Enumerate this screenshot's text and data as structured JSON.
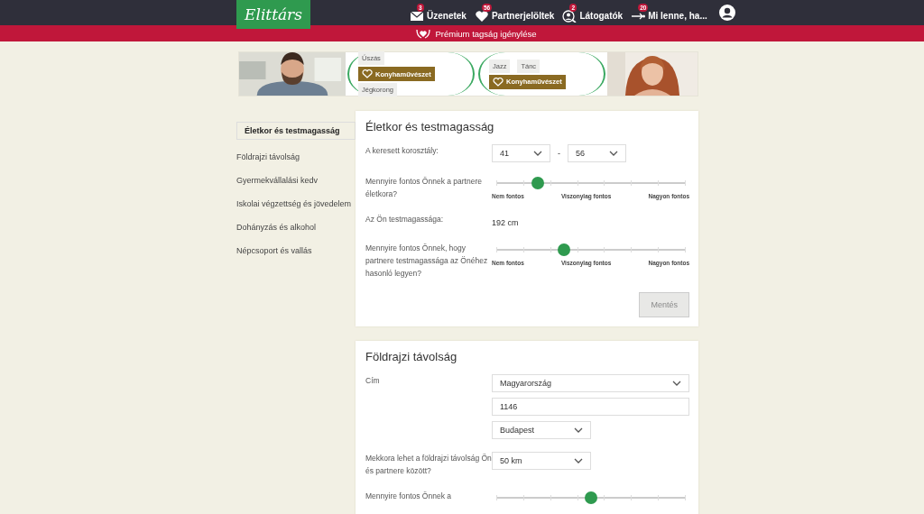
{
  "header": {
    "logo": "Elittárs",
    "nav": [
      {
        "badge": "3",
        "label": "Üzenetek"
      },
      {
        "badge": "56",
        "label": "Partnerjelöltek"
      },
      {
        "badge": "2",
        "label": "Látogatók"
      },
      {
        "badge": "20",
        "label": "Mi lenne, ha..."
      }
    ]
  },
  "premium_bar": {
    "label": "Prémium tagság igénylése"
  },
  "banner": {
    "left_tags": [
      {
        "label": "Úszás",
        "kind": "plain"
      },
      {
        "label": "Konyhaművészet",
        "kind": "featured"
      },
      {
        "label": "Jégkorong",
        "kind": "plain"
      }
    ],
    "right_tags": [
      {
        "label": "Jazz",
        "kind": "plain"
      },
      {
        "label": "Tánc",
        "kind": "plain"
      },
      {
        "label": "Konyhaművészet",
        "kind": "featured"
      }
    ]
  },
  "sidebar": {
    "items": [
      {
        "label": "Életkor és testmagasság",
        "selected": true
      },
      {
        "label": "Földrajzi távolság",
        "selected": false
      },
      {
        "label": "Gyermekvállalási kedv",
        "selected": false
      },
      {
        "label": "Iskolai végzettség és jövedelem",
        "selected": false
      },
      {
        "label": "Dohányzás és alkohol",
        "selected": false
      },
      {
        "label": "Népcsoport és vallás",
        "selected": false
      }
    ]
  },
  "sections": [
    {
      "title": "Életkor és testmagasság",
      "rows": [
        {
          "kind": "range",
          "label": "A keresett korosztály:",
          "from": "41",
          "separator": "-",
          "to": "56"
        },
        {
          "kind": "slider",
          "label": "Mennyire fontos Önnek a partnere életkora?",
          "level": 0.22,
          "scale": [
            "Nem fontos",
            "Viszonylag fontos",
            "Nagyon fontos"
          ]
        },
        {
          "kind": "value",
          "label": "Az Ön testmagassága:",
          "value": "192 cm"
        },
        {
          "kind": "slider",
          "label": "Mennyire fontos Önnek, hogy partnere testmagassága az Önéhez hasonló legyen?",
          "level": 0.36,
          "scale": [
            "Nem fontos",
            "Viszonylag fontos",
            "Nagyon fontos"
          ]
        }
      ],
      "save_button": {
        "label": "Mentés",
        "disabled": true
      }
    },
    {
      "title": "Földrajzi távolság",
      "rows": [
        {
          "kind": "address",
          "label": "Cím",
          "country": "Magyarország",
          "zip": "1146",
          "city": "Budapest"
        },
        {
          "kind": "select",
          "label": "Mekkora lehet a földrajzi távolság Ön és partnere között?",
          "value": "50 km"
        },
        {
          "kind": "slider",
          "label": "Mennyire fontos Önnek a",
          "level": 0.5
        }
      ]
    }
  ]
}
